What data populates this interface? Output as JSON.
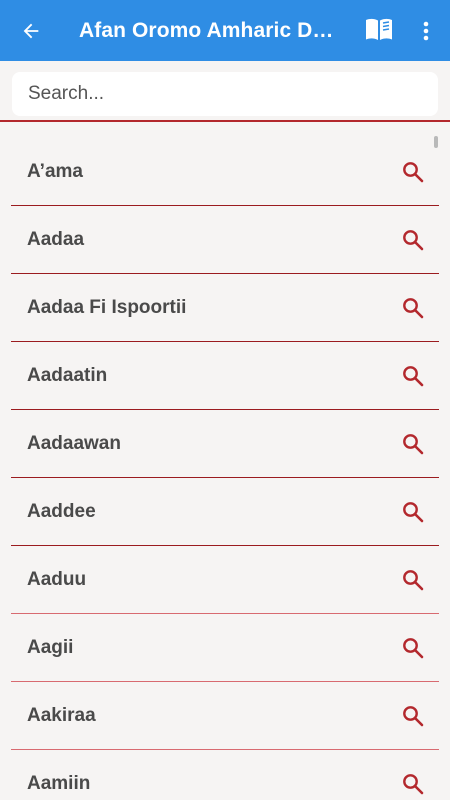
{
  "appbar": {
    "title": "Afan Oromo Amharic Dictionary",
    "back_icon": "arrow-back-icon",
    "book_icon": "open-book-icon",
    "more_icon": "more-vert-icon",
    "color": "#2f8de4"
  },
  "search": {
    "placeholder": "Search...",
    "value": ""
  },
  "list": {
    "accent": "#b3282d",
    "items": [
      {
        "label": "A’ama"
      },
      {
        "label": "Aadaa"
      },
      {
        "label": "Aadaa Fi Ispoortii"
      },
      {
        "label": "Aadaatin"
      },
      {
        "label": "Aadaawan"
      },
      {
        "label": "Aaddee"
      },
      {
        "label": "Aaduu"
      },
      {
        "label": "Aagii"
      },
      {
        "label": "Aakiraa"
      },
      {
        "label": "Aamiin"
      }
    ]
  }
}
